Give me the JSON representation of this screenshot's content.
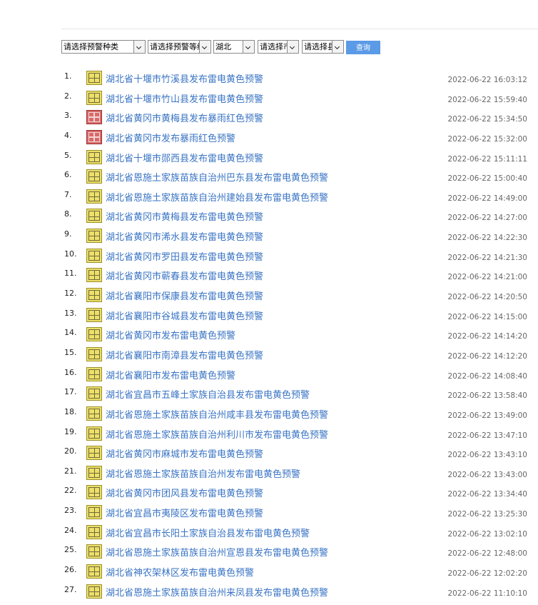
{
  "filters": {
    "type_label": "请选择预警种类",
    "level_label": "请选择预警等级",
    "province_label": "湖北",
    "city_label": "请选择市",
    "county_label": "请选择县",
    "query_label": "查询"
  },
  "warnings": [
    {
      "num": "1.",
      "title": "湖北省十堰市竹溪县发布雷电黄色预警",
      "time": "2022-06-22 16:03:12",
      "icon": "lightning-yellow-icon"
    },
    {
      "num": "2.",
      "title": "湖北省十堰市竹山县发布雷电黄色预警",
      "time": "2022-06-22 15:59:40",
      "icon": "lightning-yellow-icon"
    },
    {
      "num": "3.",
      "title": "湖北省黄冈市黄梅县发布暴雨红色预警",
      "time": "2022-06-22 15:34:50",
      "icon": "rainstorm-red-icon"
    },
    {
      "num": "4.",
      "title": "湖北省黄冈市发布暴雨红色预警",
      "time": "2022-06-22 15:32:00",
      "icon": "rainstorm-red-icon"
    },
    {
      "num": "5.",
      "title": "湖北省十堰市郧西县发布雷电黄色预警",
      "time": "2022-06-22 15:11:11",
      "icon": "lightning-yellow-icon"
    },
    {
      "num": "6.",
      "title": "湖北省恩施土家族苗族自治州巴东县发布雷电黄色预警",
      "time": "2022-06-22 15:00:40",
      "icon": "lightning-yellow-icon"
    },
    {
      "num": "7.",
      "title": "湖北省恩施土家族苗族自治州建始县发布雷电黄色预警",
      "time": "2022-06-22 14:49:00",
      "icon": "lightning-yellow-icon"
    },
    {
      "num": "8.",
      "title": "湖北省黄冈市黄梅县发布雷电黄色预警",
      "time": "2022-06-22 14:27:00",
      "icon": "lightning-yellow-icon"
    },
    {
      "num": "9.",
      "title": "湖北省黄冈市浠水县发布雷电黄色预警",
      "time": "2022-06-22 14:22:30",
      "icon": "lightning-yellow-icon"
    },
    {
      "num": "10.",
      "title": "湖北省黄冈市罗田县发布雷电黄色预警",
      "time": "2022-06-22 14:21:30",
      "icon": "lightning-yellow-icon"
    },
    {
      "num": "11.",
      "title": "湖北省黄冈市蕲春县发布雷电黄色预警",
      "time": "2022-06-22 14:21:00",
      "icon": "lightning-yellow-icon"
    },
    {
      "num": "12.",
      "title": "湖北省襄阳市保康县发布雷电黄色预警",
      "time": "2022-06-22 14:20:50",
      "icon": "lightning-yellow-icon"
    },
    {
      "num": "13.",
      "title": "湖北省襄阳市谷城县发布雷电黄色预警",
      "time": "2022-06-22 14:15:00",
      "icon": "lightning-yellow-icon"
    },
    {
      "num": "14.",
      "title": "湖北省黄冈市发布雷电黄色预警",
      "time": "2022-06-22 14:14:20",
      "icon": "lightning-yellow-icon"
    },
    {
      "num": "15.",
      "title": "湖北省襄阳市南漳县发布雷电黄色预警",
      "time": "2022-06-22 14:12:20",
      "icon": "lightning-yellow-icon"
    },
    {
      "num": "16.",
      "title": "湖北省襄阳市发布雷电黄色预警",
      "time": "2022-06-22 14:08:40",
      "icon": "lightning-yellow-icon"
    },
    {
      "num": "17.",
      "title": "湖北省宜昌市五峰土家族自治县发布雷电黄色预警",
      "time": "2022-06-22 13:58:40",
      "icon": "lightning-yellow-icon"
    },
    {
      "num": "18.",
      "title": "湖北省恩施土家族苗族自治州咸丰县发布雷电黄色预警",
      "time": "2022-06-22 13:49:00",
      "icon": "lightning-yellow-icon"
    },
    {
      "num": "19.",
      "title": "湖北省恩施土家族苗族自治州利川市发布雷电黄色预警",
      "time": "2022-06-22 13:47:10",
      "icon": "lightning-yellow-icon"
    },
    {
      "num": "20.",
      "title": "湖北省黄冈市麻城市发布雷电黄色预警",
      "time": "2022-06-22 13:43:10",
      "icon": "lightning-yellow-icon"
    },
    {
      "num": "21.",
      "title": "湖北省恩施土家族苗族自治州发布雷电黄色预警",
      "time": "2022-06-22 13:43:00",
      "icon": "lightning-yellow-icon"
    },
    {
      "num": "22.",
      "title": "湖北省黄冈市团风县发布雷电黄色预警",
      "time": "2022-06-22 13:34:40",
      "icon": "lightning-yellow-icon"
    },
    {
      "num": "23.",
      "title": "湖北省宜昌市夷陵区发布雷电黄色预警",
      "time": "2022-06-22 13:25:30",
      "icon": "lightning-yellow-icon"
    },
    {
      "num": "24.",
      "title": "湖北省宜昌市长阳土家族自治县发布雷电黄色预警",
      "time": "2022-06-22 13:02:10",
      "icon": "lightning-yellow-icon"
    },
    {
      "num": "25.",
      "title": "湖北省恩施土家族苗族自治州宣恩县发布雷电黄色预警",
      "time": "2022-06-22 12:48:00",
      "icon": "lightning-yellow-icon"
    },
    {
      "num": "26.",
      "title": "湖北省神农架林区发布雷电黄色预警",
      "time": "2022-06-22 12:02:20",
      "icon": "lightning-yellow-icon"
    },
    {
      "num": "27.",
      "title": "湖北省恩施土家族苗族自治州来凤县发布雷电黄色预警",
      "time": "2022-06-22 11:10:10",
      "icon": "lightning-yellow-icon"
    }
  ]
}
